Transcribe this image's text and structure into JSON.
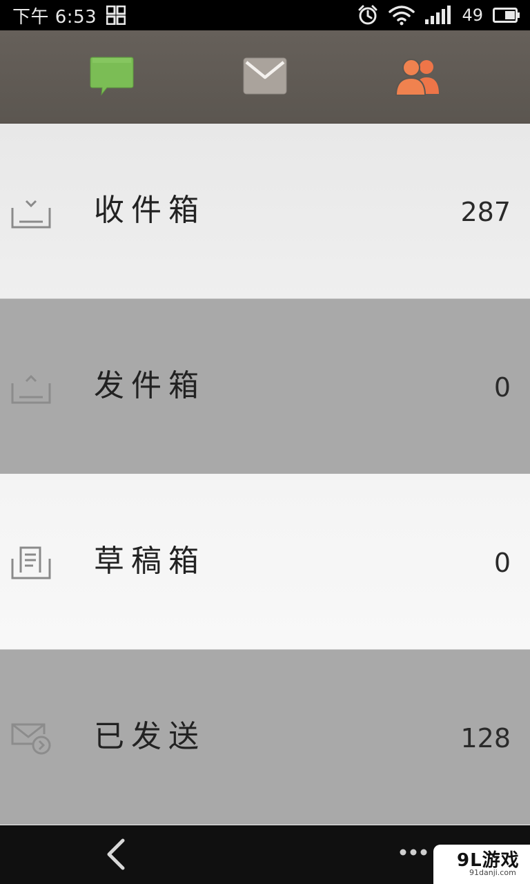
{
  "status_bar": {
    "time": "下午 6:53",
    "battery": "49"
  },
  "tabs": [
    {
      "name": "messages",
      "icon": "chat-bubble-icon",
      "color": "#7bbd55"
    },
    {
      "name": "mail",
      "icon": "envelope-icon",
      "color": "#aaa39c"
    },
    {
      "name": "contacts",
      "icon": "people-icon",
      "color": "#ee7548"
    }
  ],
  "folders": [
    {
      "label": "收件箱",
      "count": "287",
      "icon": "inbox-icon"
    },
    {
      "label": "发件箱",
      "count": "0",
      "icon": "outbox-icon"
    },
    {
      "label": "草稿箱",
      "count": "0",
      "icon": "drafts-icon"
    },
    {
      "label": "已发送",
      "count": "128",
      "icon": "sent-icon"
    }
  ],
  "watermark": {
    "main": "9L游戏",
    "sub": "91danji.com"
  }
}
